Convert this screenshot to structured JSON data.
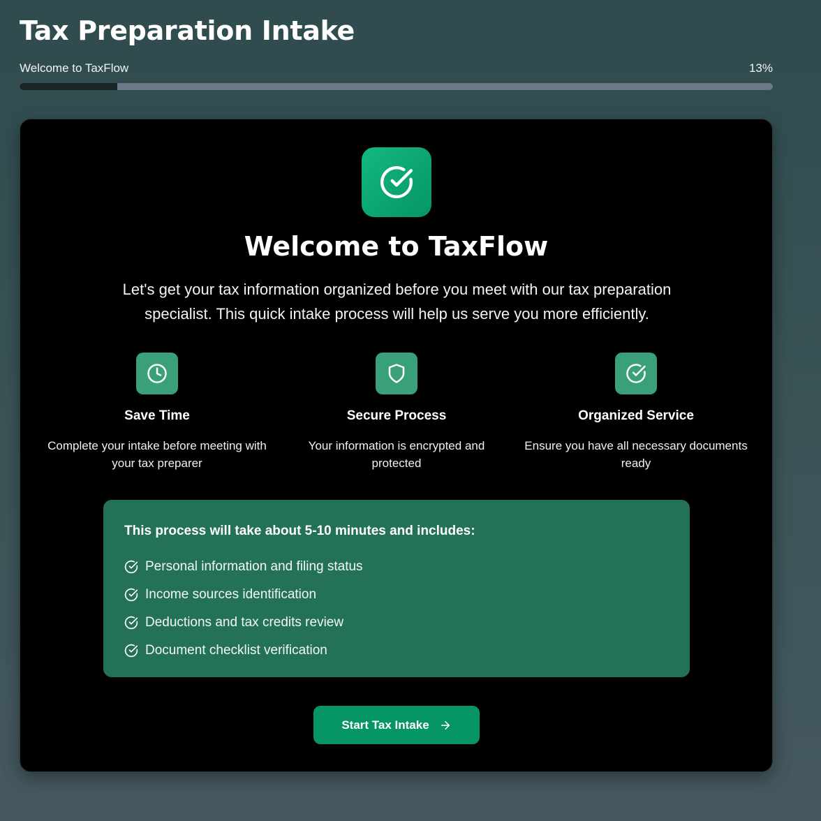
{
  "header": {
    "title": "Tax Preparation Intake",
    "step_label": "Welcome to TaxFlow",
    "progress_text": "13%",
    "progress_value": 0.13
  },
  "card": {
    "title": "Welcome to TaxFlow",
    "intro": "Let's get your tax information organized before you meet with our tax preparation specialist. This quick intake process will help us serve you more efficiently.",
    "hero_icon": "check-circle-icon",
    "features": [
      {
        "icon": "clock-icon",
        "title": "Save Time",
        "description": "Complete your intake before meeting with your tax preparer"
      },
      {
        "icon": "shield-icon",
        "title": "Secure Process",
        "description": "Your information is encrypted and protected"
      },
      {
        "icon": "check-circle-icon",
        "title": "Organized Service",
        "description": "Ensure you have all necessary documents ready"
      }
    ],
    "info": {
      "heading": "This process will take about 5-10 minutes and includes:",
      "items": [
        "Personal information and filing status",
        "Income sources identification",
        "Deductions and tax credits review",
        "Document checklist verification"
      ]
    },
    "start_button": {
      "label": "Start Tax Intake",
      "icon": "arrow-right-icon"
    }
  },
  "colors": {
    "accent": "#069566",
    "feature_icon_bg": "#3aa079",
    "info_box_bg": "#237257",
    "card_bg": "#000000"
  }
}
